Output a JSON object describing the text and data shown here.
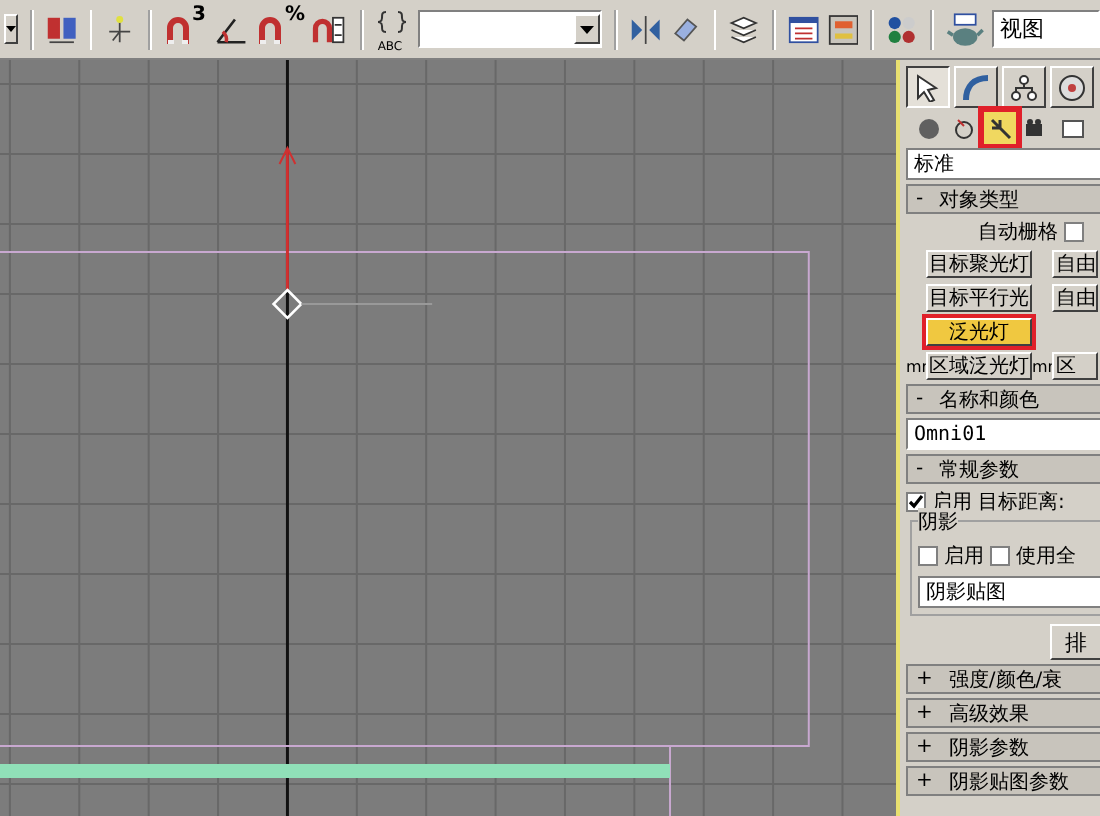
{
  "toolbar": {
    "snap_labels": [
      "3",
      "%"
    ],
    "named_selection_label": "ABC",
    "reference_field": "视图"
  },
  "command_panel": {
    "tabs": [
      {
        "kind": "create",
        "selected": true
      },
      {
        "kind": "modify",
        "selected": false
      },
      {
        "kind": "hierarchy",
        "selected": false
      },
      {
        "kind": "motion",
        "selected": false
      }
    ],
    "categories": [
      {
        "kind": "geometry",
        "selected": false,
        "highlighted": false
      },
      {
        "kind": "shapes",
        "selected": false,
        "highlighted": false
      },
      {
        "kind": "lights",
        "selected": true,
        "highlighted": true
      },
      {
        "kind": "cameras",
        "selected": false,
        "highlighted": false
      },
      {
        "kind": "helpers",
        "selected": false,
        "highlighted": false
      }
    ],
    "subcategory": "标准",
    "object_type": {
      "sign": "-",
      "title": "对象类型",
      "autogrid_label": "自动栅格",
      "autogrid_checked": false,
      "button_rows": [
        [
          {
            "label": "目标聚光灯",
            "selected": false,
            "highlighted": false
          },
          {
            "label": "自由",
            "selected": false,
            "highlighted": false
          }
        ],
        [
          {
            "label": "目标平行光",
            "selected": false,
            "highlighted": false
          },
          {
            "label": "自由",
            "selected": false,
            "highlighted": false
          }
        ],
        [
          {
            "label": "泛光灯",
            "selected": true,
            "highlighted": true
          }
        ],
        [
          {
            "prefix": "mr",
            "label": "区域泛光灯",
            "selected": false,
            "highlighted": false
          },
          {
            "prefix": "mr",
            "label": "区",
            "selected": false,
            "highlighted": false
          }
        ]
      ]
    },
    "name_color": {
      "sign": "-",
      "title": "名称和颜色",
      "name": "Omni01"
    },
    "general": {
      "sign": "-",
      "title": "常规参数",
      "on_label": "启用",
      "on_checked": true,
      "target_distance_label": "目标距离:",
      "shadow_group": "阴影",
      "shadow_on_label": "启用",
      "shadow_on_checked": false,
      "global_label": "使用全",
      "global_checked": false,
      "shadow_type": "阴影贴图",
      "exclude_button": "排"
    },
    "collapsed": [
      {
        "sign": "+",
        "title": "强度/颜色/衰"
      },
      {
        "sign": "+",
        "title": "高级效果"
      },
      {
        "sign": "+",
        "title": "阴影参数"
      },
      {
        "sign": "+",
        "title": "阴影贴图参数"
      }
    ]
  }
}
